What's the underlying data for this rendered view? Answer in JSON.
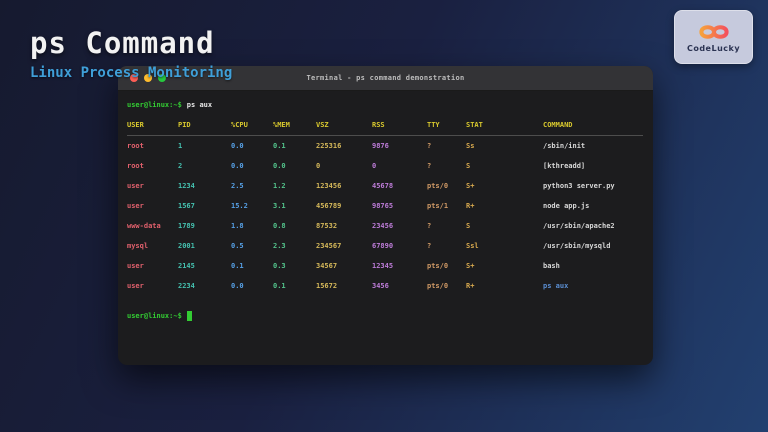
{
  "page": {
    "title": "ps Command",
    "subtitle": "Linux Process Monitoring"
  },
  "logo": {
    "label": "CodeLucky",
    "icon": "infinity-icon"
  },
  "terminal": {
    "window_title": "Terminal - ps command demonstration",
    "prompt": "user@linux:~$",
    "command": "ps aux",
    "final_prompt": "user@linux:~$",
    "columns": [
      "USER",
      "PID",
      "%CPU",
      "%MEM",
      "VSZ",
      "RSS",
      "TTY",
      "STAT",
      "COMMAND"
    ],
    "rows": [
      {
        "cells": [
          "root",
          "1",
          "0.0",
          "0.1",
          "225316",
          "9876",
          "?",
          "Ss",
          "/sbin/init"
        ],
        "highlight_command": false
      },
      {
        "cells": [
          "root",
          "2",
          "0.0",
          "0.0",
          "0",
          "0",
          "?",
          "S",
          "[kthreadd]"
        ],
        "highlight_command": false
      },
      {
        "cells": [
          "user",
          "1234",
          "2.5",
          "1.2",
          "123456",
          "45678",
          "pts/0",
          "S+",
          "python3 server.py"
        ],
        "highlight_command": false
      },
      {
        "cells": [
          "user",
          "1567",
          "15.2",
          "3.1",
          "456789",
          "98765",
          "pts/1",
          "R+",
          "node app.js"
        ],
        "highlight_command": false
      },
      {
        "cells": [
          "www-data",
          "1789",
          "1.8",
          "0.8",
          "87532",
          "23456",
          "?",
          "S",
          "/usr/sbin/apache2"
        ],
        "highlight_command": false
      },
      {
        "cells": [
          "mysql",
          "2001",
          "0.5",
          "2.3",
          "234567",
          "67890",
          "?",
          "Ssl",
          "/usr/sbin/mysqld"
        ],
        "highlight_command": false
      },
      {
        "cells": [
          "user",
          "2145",
          "0.1",
          "0.3",
          "34567",
          "12345",
          "pts/0",
          "S+",
          "bash"
        ],
        "highlight_command": false
      },
      {
        "cells": [
          "user",
          "2234",
          "0.0",
          "0.1",
          "15672",
          "3456",
          "pts/0",
          "R+",
          "ps aux"
        ],
        "highlight_command": true
      }
    ]
  },
  "colors": {
    "bg-from": "#161a2f",
    "bg-mid": "#1a2040",
    "bg-to": "#224070",
    "title-white": "#f2f2f2",
    "accent-blue": "#3f9fd8",
    "term-bg": "#1c1c1e",
    "term-bar": "#333336",
    "term-title": "#bdbdbd",
    "dot-red": "#ff5f56",
    "dot-yellow": "#ffbd2e",
    "dot-green": "#27c93f",
    "prompt-green": "#33cc33",
    "header-yellow": "#d9c92e",
    "col-user": "#e0606c",
    "col-pid": "#45c1b0",
    "col-cpu": "#56a0e6",
    "col-mem": "#53c48c",
    "col-vsz": "#d5b85a",
    "col-rss": "#bd7cd8",
    "col-tty": "#d19a66",
    "col-stat": "#d8a94e",
    "col-command": "#d8d8d8",
    "col-command-active": "#5b8fd4",
    "logo-bg": "#c6cadd",
    "logo-text": "#2b3352",
    "logo-grad-start": "#f6a13c",
    "logo-grad-end": "#f4515c"
  }
}
